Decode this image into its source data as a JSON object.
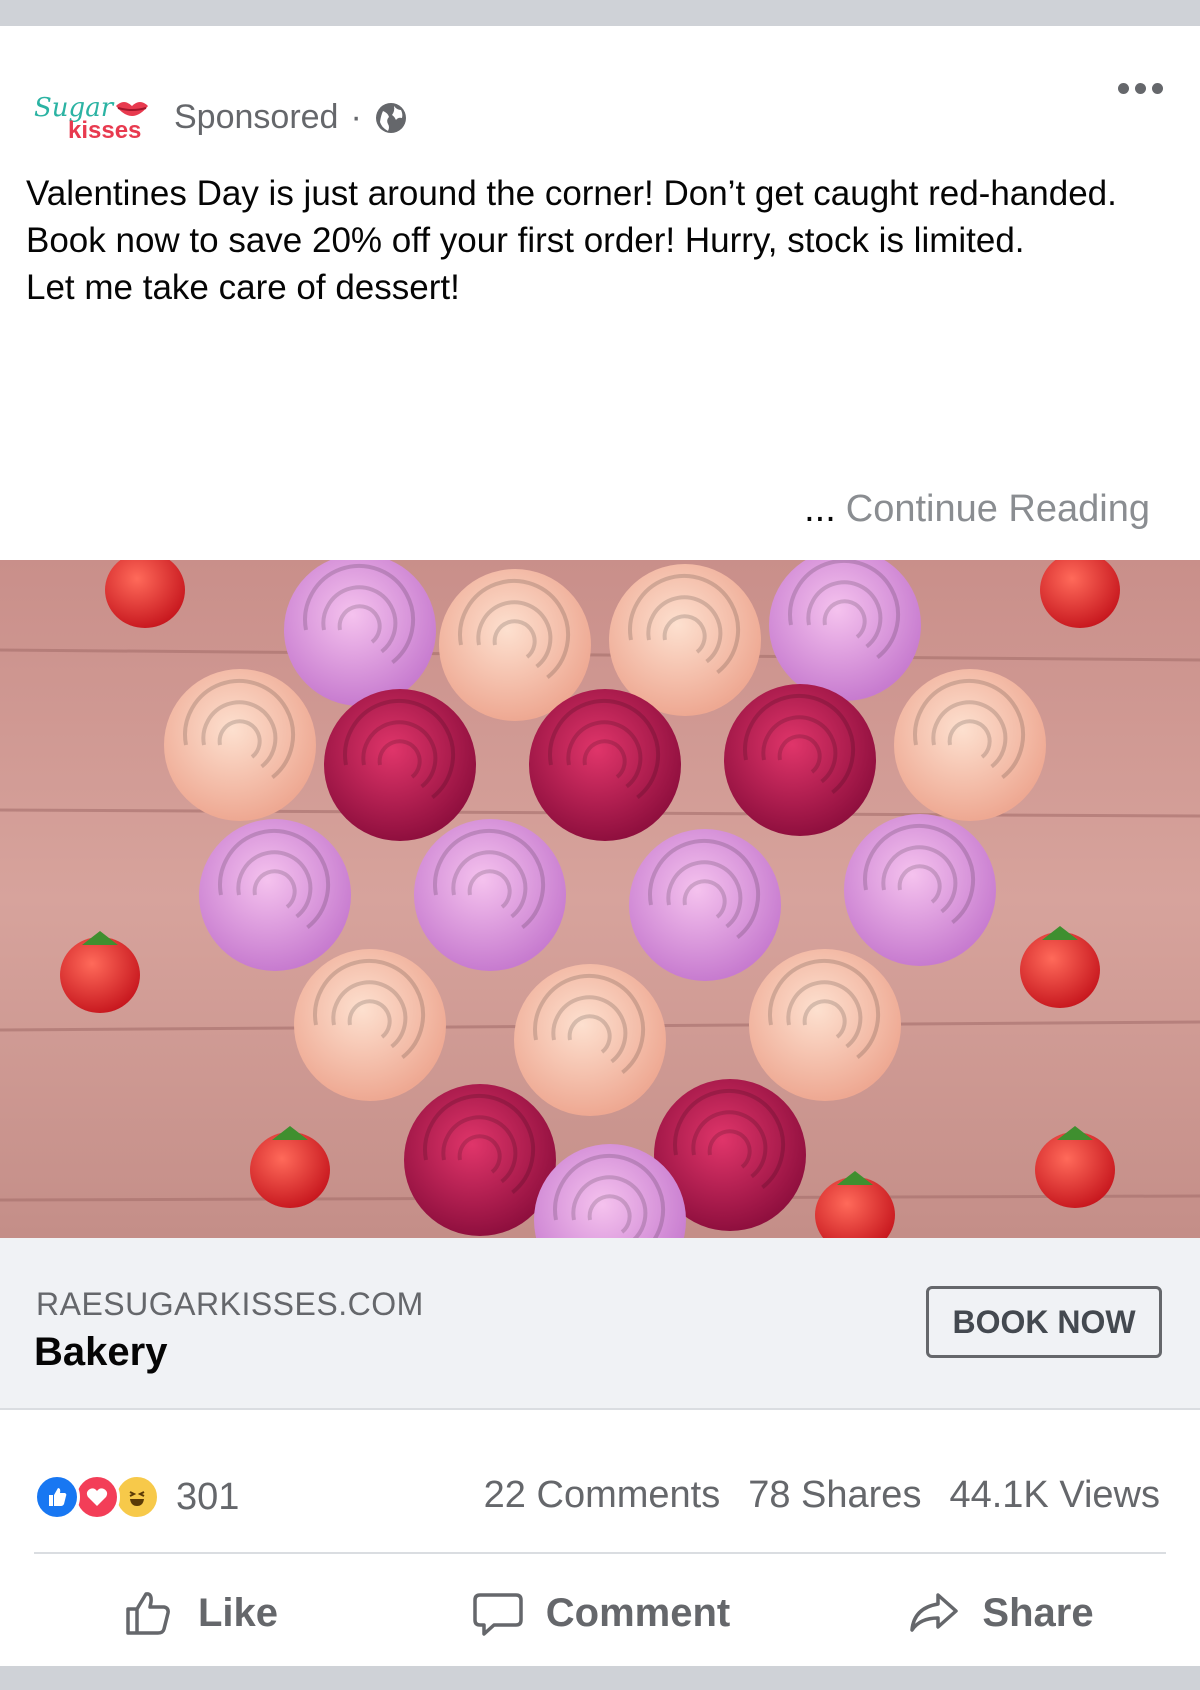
{
  "post": {
    "page_logo": {
      "line1": "Sugar",
      "line2": "kisses"
    },
    "sponsored_label": "Sponsored",
    "separator": "·",
    "text_lines": [
      "Valentines Day is just around the corner! Don’t get caught red-handed.",
      "Book now to save 20% off your first order! Hurry, stock is limited.",
      "Let me take care of dessert!"
    ],
    "continue_ellipsis": "...",
    "continue_label": "Continue Reading"
  },
  "link": {
    "domain": "RAESUGARKISSES.COM",
    "category": "Bakery",
    "cta_label": "BOOK NOW"
  },
  "engagement": {
    "reaction_count": "301",
    "comments": "22 Comments",
    "shares": "78 Shares",
    "views": "44.1K Views"
  },
  "actions": {
    "like": "Like",
    "comment": "Comment",
    "share": "Share"
  },
  "colors": {
    "facebook_blue": "#1877f2",
    "love_red": "#f33e58",
    "haha_yellow": "#f7c94a",
    "brand_teal": "#2bb3a3",
    "brand_red": "#e83a4f"
  }
}
